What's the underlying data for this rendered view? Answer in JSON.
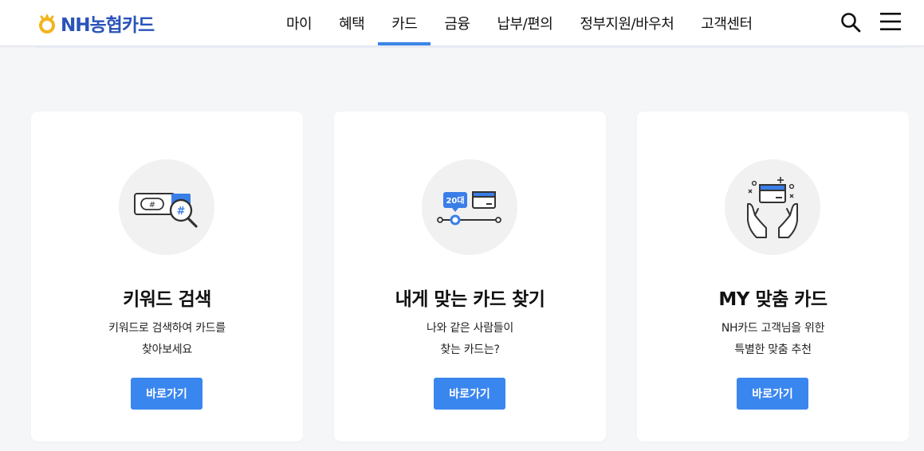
{
  "header": {
    "logo": {
      "mark": "NH",
      "text": "NH농협카드",
      "icon": "nh-logo-icon"
    },
    "nav": [
      {
        "label": "마이"
      },
      {
        "label": "혜택"
      },
      {
        "label": "카드",
        "active": true
      },
      {
        "label": "금융"
      },
      {
        "label": "납부/편의"
      },
      {
        "label": "정부지원/바우처"
      },
      {
        "label": "고객센터"
      }
    ],
    "search_icon": "search-icon",
    "menu_icon": "hamburger-menu-icon"
  },
  "cards": [
    {
      "icon": "keyword-search-icon",
      "icon_tag_left": "#",
      "icon_tag_right": "#",
      "title": "키워드 검색",
      "desc_line1": "키워드로 검색하여 카드를",
      "desc_line2": "찾아보세요",
      "button": "바로가기"
    },
    {
      "icon": "age-card-match-icon",
      "icon_badge": "20대",
      "title": "내게 맞는 카드 찾기",
      "desc_line1": "나와 같은 사람들이",
      "desc_line2": "찾는 카드는?",
      "button": "바로가기"
    },
    {
      "icon": "hands-card-icon",
      "title": "MY 맞춤 카드",
      "desc_line1": "NH카드 고객님을 위한",
      "desc_line2": "특별한 맞춤 추천",
      "button": "바로가기"
    }
  ],
  "colors": {
    "accent": "#3a86ef",
    "nav_active_underline": "#3a86e6",
    "logo_blue": "#2a54b8",
    "logo_gold": "#f2b41c",
    "page_bg": "#f5f6f8"
  }
}
